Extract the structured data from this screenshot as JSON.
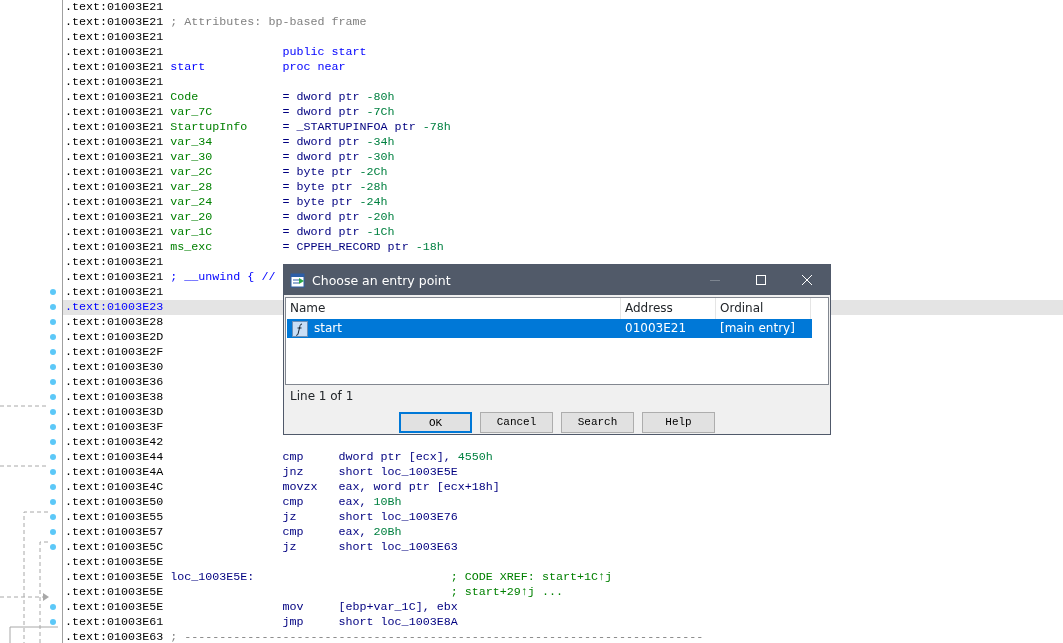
{
  "listing": {
    "lines": [
      {
        "address": ".text:01003E21",
        "selected": false,
        "dot": false
      },
      {
        "address": ".text:01003E21",
        "selected": false,
        "dot": false,
        "note": {
          "text": "; Attributes: bp-based frame",
          "kind": "comment"
        }
      },
      {
        "address": ".text:01003E21",
        "selected": false,
        "dot": false
      },
      {
        "address": ".text:01003E21",
        "selected": false,
        "dot": false,
        "operands": [
          {
            "text": "public start",
            "kind": "keyword"
          }
        ]
      },
      {
        "address": ".text:01003E21",
        "selected": false,
        "dot": false,
        "label": {
          "text": "start",
          "kind": "keyword"
        },
        "operands": [
          {
            "text": "proc near",
            "kind": "keyword"
          }
        ]
      },
      {
        "address": ".text:01003E21",
        "selected": false,
        "dot": false
      },
      {
        "address": ".text:01003E21",
        "selected": false,
        "dot": false,
        "label": {
          "text": "Code",
          "kind": "name"
        },
        "operands": [
          {
            "text": "= dword ptr",
            "kind": "code"
          },
          {
            "text": "-80h",
            "kind": "number"
          }
        ]
      },
      {
        "address": ".text:01003E21",
        "selected": false,
        "dot": false,
        "label": {
          "text": "var_7C",
          "kind": "name"
        },
        "operands": [
          {
            "text": "= dword ptr",
            "kind": "code"
          },
          {
            "text": "-7Ch",
            "kind": "number"
          }
        ]
      },
      {
        "address": ".text:01003E21",
        "selected": false,
        "dot": false,
        "label": {
          "text": "StartupInfo",
          "kind": "name"
        },
        "operands": [
          {
            "text": "= _STARTUPINFOA ptr",
            "kind": "code"
          },
          {
            "text": "-78h",
            "kind": "number"
          }
        ]
      },
      {
        "address": ".text:01003E21",
        "selected": false,
        "dot": false,
        "label": {
          "text": "var_34",
          "kind": "name"
        },
        "operands": [
          {
            "text": "= dword ptr",
            "kind": "code"
          },
          {
            "text": "-34h",
            "kind": "number"
          }
        ]
      },
      {
        "address": ".text:01003E21",
        "selected": false,
        "dot": false,
        "label": {
          "text": "var_30",
          "kind": "name"
        },
        "operands": [
          {
            "text": "= dword ptr",
            "kind": "code"
          },
          {
            "text": "-30h",
            "kind": "number"
          }
        ]
      },
      {
        "address": ".text:01003E21",
        "selected": false,
        "dot": false,
        "label": {
          "text": "var_2C",
          "kind": "name"
        },
        "operands": [
          {
            "text": "= byte ptr",
            "kind": "code"
          },
          {
            "text": "-2Ch",
            "kind": "number"
          }
        ]
      },
      {
        "address": ".text:01003E21",
        "selected": false,
        "dot": false,
        "label": {
          "text": "var_28",
          "kind": "name"
        },
        "operands": [
          {
            "text": "= byte ptr",
            "kind": "code"
          },
          {
            "text": "-28h",
            "kind": "number"
          }
        ]
      },
      {
        "address": ".text:01003E21",
        "selected": false,
        "dot": false,
        "label": {
          "text": "var_24",
          "kind": "name"
        },
        "operands": [
          {
            "text": "= byte ptr",
            "kind": "code"
          },
          {
            "text": "-24h",
            "kind": "number"
          }
        ]
      },
      {
        "address": ".text:01003E21",
        "selected": false,
        "dot": false,
        "label": {
          "text": "var_20",
          "kind": "name"
        },
        "operands": [
          {
            "text": "= dword ptr",
            "kind": "code"
          },
          {
            "text": "-20h",
            "kind": "number"
          }
        ]
      },
      {
        "address": ".text:01003E21",
        "selected": false,
        "dot": false,
        "label": {
          "text": "var_1C",
          "kind": "name"
        },
        "operands": [
          {
            "text": "= dword ptr",
            "kind": "code"
          },
          {
            "text": "-1Ch",
            "kind": "number"
          }
        ]
      },
      {
        "address": ".text:01003E21",
        "selected": false,
        "dot": false,
        "label": {
          "text": "ms_exc",
          "kind": "name"
        },
        "operands": [
          {
            "text": "= CPPEH_RECORD ptr",
            "kind": "code"
          },
          {
            "text": "-18h",
            "kind": "number"
          }
        ]
      },
      {
        "address": ".text:01003E21",
        "selected": false,
        "dot": false
      },
      {
        "address": ".text:01003E21",
        "selected": false,
        "dot": false,
        "note": {
          "text": "; __unwind { //",
          "kind": "keyword"
        }
      },
      {
        "address": ".text:01003E21",
        "selected": false,
        "dot": true
      },
      {
        "address": ".text:01003E23",
        "selected": true,
        "dot": true
      },
      {
        "address": ".text:01003E28",
        "selected": false,
        "dot": true
      },
      {
        "address": ".text:01003E2D",
        "selected": false,
        "dot": true
      },
      {
        "address": ".text:01003E2F",
        "selected": false,
        "dot": true
      },
      {
        "address": ".text:01003E30",
        "selected": false,
        "dot": true
      },
      {
        "address": ".text:01003E36",
        "selected": false,
        "dot": true
      },
      {
        "address": ".text:01003E38",
        "selected": false,
        "dot": true
      },
      {
        "address": ".text:01003E3D",
        "selected": false,
        "dot": true
      },
      {
        "address": ".text:01003E3F",
        "selected": false,
        "dot": true
      },
      {
        "address": ".text:01003E42",
        "selected": false,
        "dot": true
      },
      {
        "address": ".text:01003E44",
        "selected": false,
        "dot": true,
        "mnemonic": "cmp",
        "operands": [
          {
            "text": "dword ptr [ecx],",
            "kind": "code"
          },
          {
            "text": "4550h",
            "kind": "number"
          }
        ]
      },
      {
        "address": ".text:01003E4A",
        "selected": false,
        "dot": true,
        "mnemonic": "jnz",
        "operands": [
          {
            "text": "short loc_1003E5E",
            "kind": "code"
          }
        ]
      },
      {
        "address": ".text:01003E4C",
        "selected": false,
        "dot": true,
        "mnemonic": "movzx",
        "operands": [
          {
            "text": "eax, word ptr [ecx+18h]",
            "kind": "code"
          }
        ]
      },
      {
        "address": ".text:01003E50",
        "selected": false,
        "dot": true,
        "mnemonic": "cmp",
        "operands": [
          {
            "text": "eax,",
            "kind": "code"
          },
          {
            "text": "10Bh",
            "kind": "number"
          }
        ]
      },
      {
        "address": ".text:01003E55",
        "selected": false,
        "dot": true,
        "mnemonic": "jz",
        "operands": [
          {
            "text": "short loc_1003E76",
            "kind": "code"
          }
        ]
      },
      {
        "address": ".text:01003E57",
        "selected": false,
        "dot": true,
        "mnemonic": "cmp",
        "operands": [
          {
            "text": "eax,",
            "kind": "code"
          },
          {
            "text": "20Bh",
            "kind": "number"
          }
        ]
      },
      {
        "address": ".text:01003E5C",
        "selected": false,
        "dot": true,
        "mnemonic": "jz",
        "operands": [
          {
            "text": "short loc_1003E63",
            "kind": "code"
          }
        ]
      },
      {
        "address": ".text:01003E5E",
        "selected": false,
        "dot": false
      },
      {
        "address": ".text:01003E5E",
        "selected": false,
        "dot": false,
        "label": {
          "text": "loc_1003E5E:",
          "kind": "code"
        },
        "comment": {
          "text": "; CODE XREF: start+1C↑j",
          "kind": "xref"
        }
      },
      {
        "address": ".text:01003E5E",
        "selected": false,
        "dot": false,
        "comment": {
          "text": "; start+29↑j ...",
          "kind": "xref"
        }
      },
      {
        "address": ".text:01003E5E",
        "selected": false,
        "dot": true,
        "mnemonic": "mov",
        "operands": [
          {
            "text": "[ebp+var_1C], ebx",
            "kind": "code"
          }
        ]
      },
      {
        "address": ".text:01003E61",
        "selected": false,
        "dot": true,
        "mnemonic": "jmp",
        "operands": [
          {
            "text": "short loc_1003E8A",
            "kind": "code"
          }
        ]
      },
      {
        "address": ".text:01003E63",
        "selected": false,
        "dot": false,
        "note": {
          "text": "; --------------------------------------------------------------------------",
          "kind": "comment"
        }
      }
    ]
  },
  "dialog": {
    "title": "Choose an entry point",
    "controls": [
      {
        "kind": "minimize",
        "disabled": true
      },
      {
        "kind": "maximize",
        "disabled": false
      },
      {
        "kind": "close",
        "disabled": false
      }
    ],
    "columns": [
      "Name",
      "Address",
      "Ordinal"
    ],
    "rows": [
      {
        "name": "start",
        "address": "01003E21",
        "ordinal": "[main entry]",
        "selected": true
      }
    ],
    "status": "Line 1 of 1",
    "buttons": [
      {
        "label": "OK",
        "default": true
      },
      {
        "label": "Cancel",
        "default": false
      },
      {
        "label": "Search",
        "default": false
      },
      {
        "label": "Help",
        "default": false
      }
    ]
  }
}
